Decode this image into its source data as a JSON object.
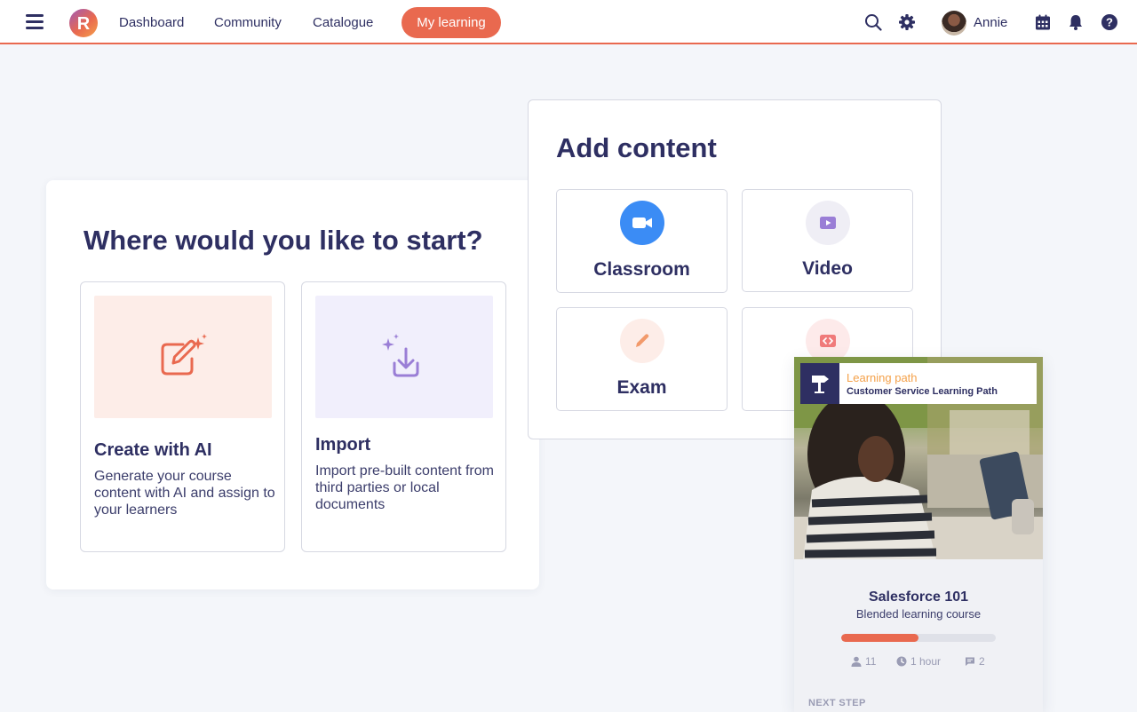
{
  "topbar": {
    "nav": [
      "Dashboard",
      "Community",
      "Catalogue"
    ],
    "active_nav": "My learning",
    "user_name": "Annie",
    "accent_color": "#e9694f",
    "icons": [
      "menu-icon",
      "search-icon",
      "gear-icon",
      "calendar-icon",
      "bell-icon",
      "help-icon"
    ]
  },
  "start": {
    "title": "Where would you like to start?",
    "options": [
      {
        "title": "Create with AI",
        "description": "Generate your course content with AI and assign to your learners",
        "icon": "edit-sparkle-icon",
        "bg": "#fdede8"
      },
      {
        "title": "Import",
        "description": "Import pre-built content from third parties or local documents",
        "icon": "import-icon",
        "bg": "#f1effc"
      }
    ]
  },
  "add_content": {
    "title": "Add content",
    "tiles": [
      {
        "label": "Classroom",
        "icon": "video-camera-icon"
      },
      {
        "label": "Video",
        "icon": "play-icon"
      },
      {
        "label": "Exam",
        "icon": "pencil-icon"
      },
      {
        "label": "",
        "icon": "code-icon"
      }
    ]
  },
  "learning_path": {
    "kicker": "Learning path",
    "name": "Customer Service Learning Path",
    "course_title": "Salesforce 101",
    "course_type": "Blended learning course",
    "progress": 0.5,
    "learners": "11",
    "duration": "1 hour",
    "comments": "2",
    "next_step_label": "NEXT STEP"
  }
}
